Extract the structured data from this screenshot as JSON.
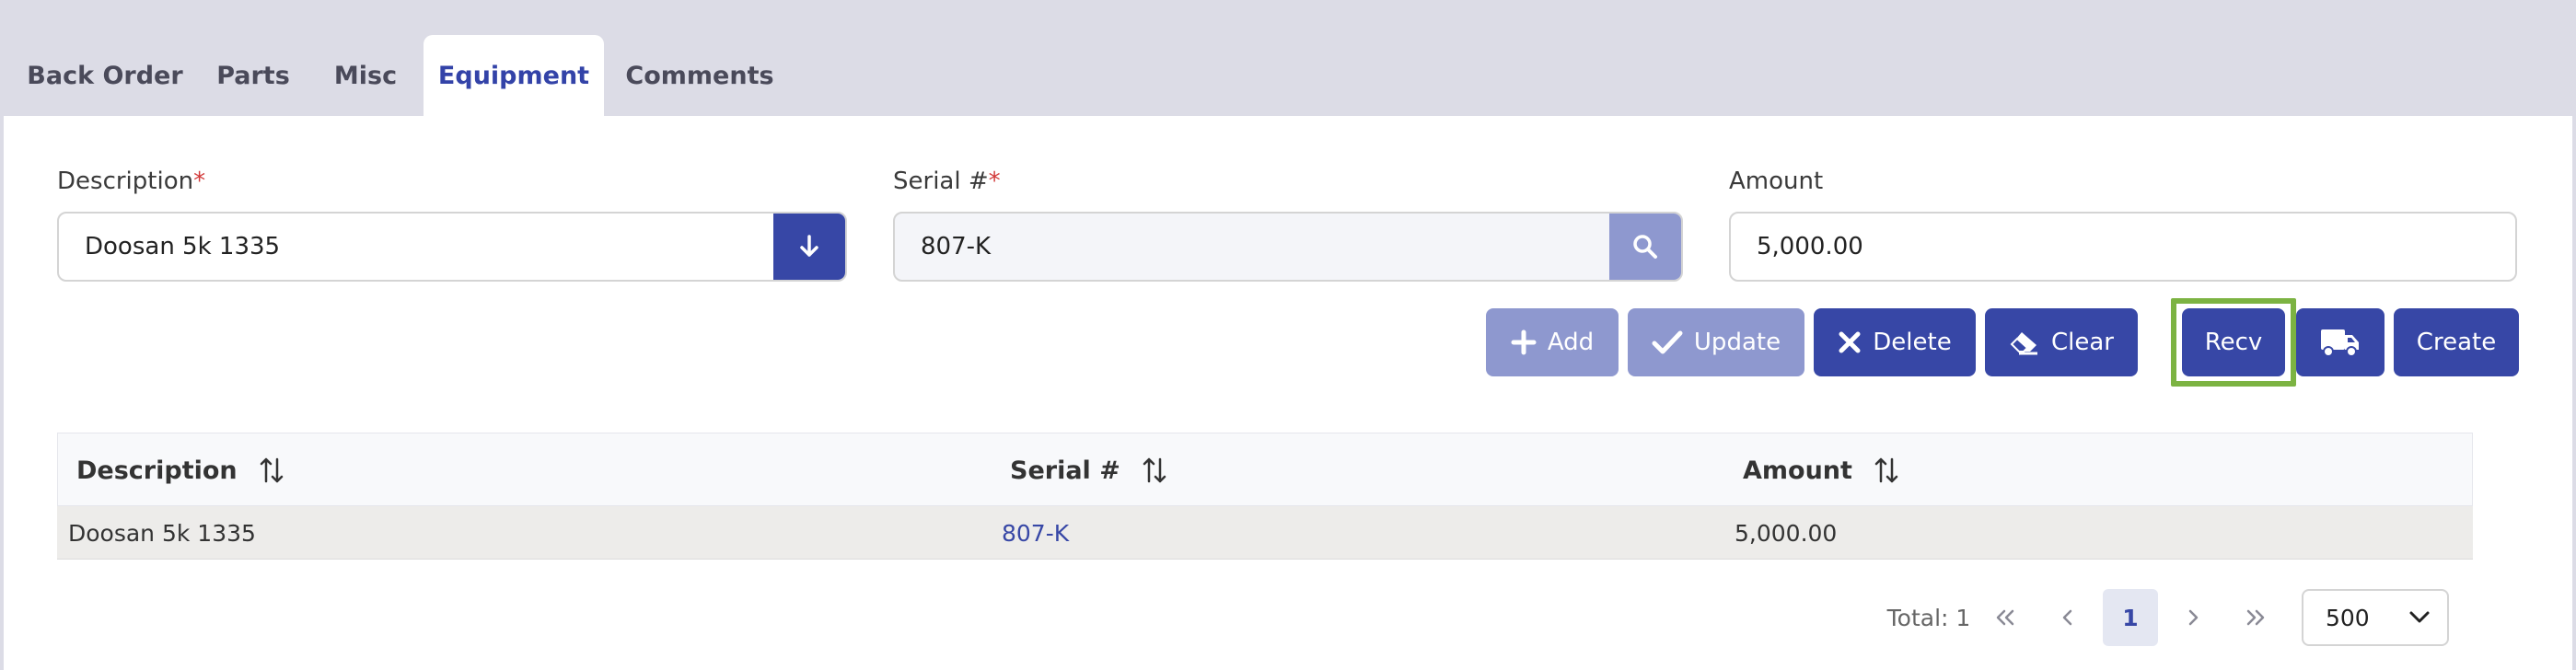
{
  "tabs": [
    {
      "label": "Back Order",
      "active": false
    },
    {
      "label": "Parts",
      "active": false
    },
    {
      "label": "Misc",
      "active": false
    },
    {
      "label": "Equipment",
      "active": true
    },
    {
      "label": "Comments",
      "active": false
    }
  ],
  "form": {
    "description": {
      "label": "Description",
      "required_mark": "*",
      "value": "Doosan 5k 1335"
    },
    "serial": {
      "label": "Serial #",
      "required_mark": "*",
      "value": "807-K"
    },
    "amount": {
      "label": "Amount",
      "value": "5,000.00"
    }
  },
  "buttons": {
    "add": "Add",
    "update": "Update",
    "delete": "Delete",
    "clear": "Clear",
    "recv": "Recv",
    "create": "Create"
  },
  "icons": {
    "description_addon": "arrow-down-icon",
    "serial_addon": "search-icon",
    "add": "plus-icon",
    "update": "check-icon",
    "delete": "x-icon",
    "clear": "eraser-icon",
    "ship": "truck-icon",
    "sort": "sort-icon"
  },
  "table": {
    "columns": [
      "Description",
      "Serial #",
      "Amount"
    ],
    "rows": [
      {
        "description": "Doosan 5k 1335",
        "serial": "807-K",
        "amount": "5,000.00"
      }
    ]
  },
  "pagination": {
    "total_label": "Total: 1",
    "current_page": "1",
    "page_size": "500"
  },
  "colors": {
    "primary": "#3747a6",
    "primary_disabled": "#8e98cf",
    "highlight": "#7cb342",
    "required": "#d23a3a",
    "tab_active_text": "#3343a8"
  }
}
